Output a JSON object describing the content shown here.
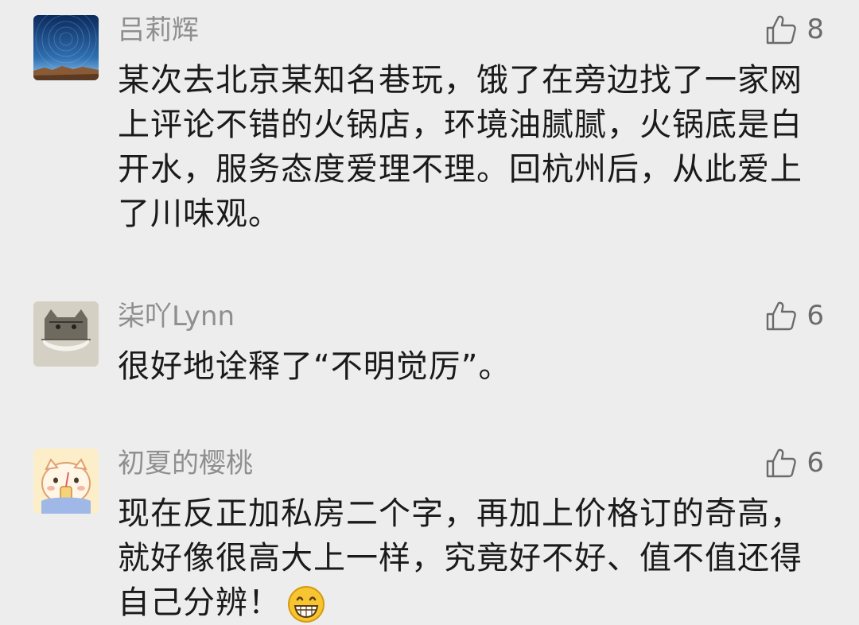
{
  "comments": [
    {
      "user": "吕莉辉",
      "likes": "8",
      "text": "某次去北京某知名巷玩，饿了在旁边找了一家网上评论不错的火锅店，环境油腻腻，火锅底是白开水，服务态度爱理不理。回杭州后，从此爱上了川味观。",
      "avatar_icon": "starry-night-sky-avatar"
    },
    {
      "user": "柒吖Lynn",
      "likes": "6",
      "text": "很好地诠释了“不明觉厉”。",
      "avatar_icon": "cat-drawing-avatar"
    },
    {
      "user": "初夏的樱桃",
      "likes": "6",
      "text": "现在反正加私房二个字，再加上价格订的奇高，就好像很高大上一样，究竟好不好、值不值还得自己分辨！",
      "avatar_icon": "cartoon-cat-drinking-avatar",
      "trailing_emoji": "grin-emoji"
    }
  ],
  "colors": {
    "background": "#ededed",
    "username": "#8f8f8f",
    "text": "#1a1a1a",
    "like": "#6b6b6b"
  }
}
